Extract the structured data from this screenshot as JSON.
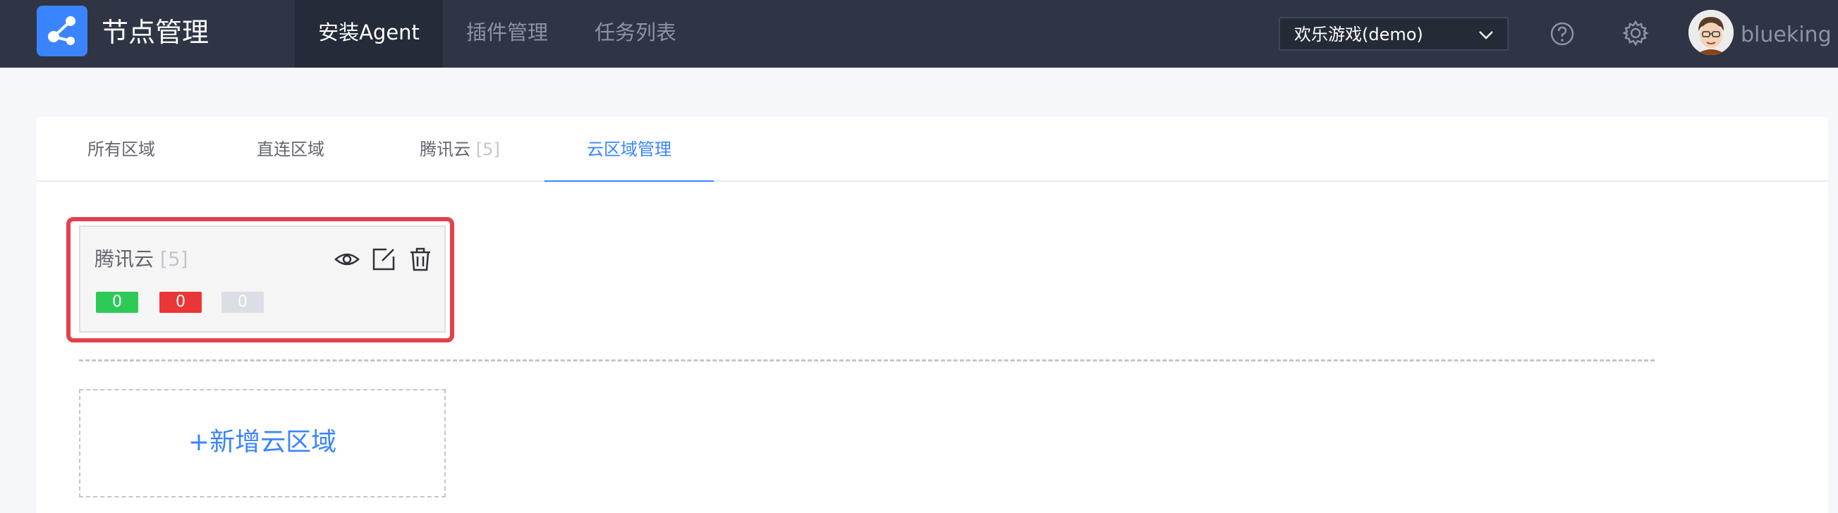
{
  "app": {
    "title": "节点管理",
    "logo_icon": "node-graph-icon"
  },
  "nav": {
    "items": [
      {
        "label": "安装Agent",
        "active": true
      },
      {
        "label": "插件管理",
        "active": false
      },
      {
        "label": "任务列表",
        "active": false
      }
    ]
  },
  "business_select": {
    "value": "欢乐游戏(demo)"
  },
  "header_icons": {
    "help": "question-circle-icon",
    "settings": "gear-icon"
  },
  "user": {
    "name": "blueking"
  },
  "tabs": [
    {
      "label": "所有区域",
      "count": "",
      "active": false
    },
    {
      "label": "直连区域",
      "count": "",
      "active": false
    },
    {
      "label": "腾讯云",
      "count": "[5]",
      "active": false
    },
    {
      "label": "云区域管理",
      "count": "",
      "active": true
    }
  ],
  "cloud_card": {
    "name": "腾讯云",
    "count": "[5]",
    "stats": {
      "normal": "0",
      "abnormal": "0",
      "unknown": "0"
    },
    "actions": [
      "eye-icon",
      "edit-icon",
      "trash-icon"
    ]
  },
  "add_area": {
    "label": "+新增云区域"
  },
  "colors": {
    "accent": "#3a84ff",
    "topbar": "#2f3545",
    "highlight": "#e5404d",
    "normal": "#2dcb56",
    "abnormal": "#ea3636",
    "unknown": "#dcdee5"
  }
}
